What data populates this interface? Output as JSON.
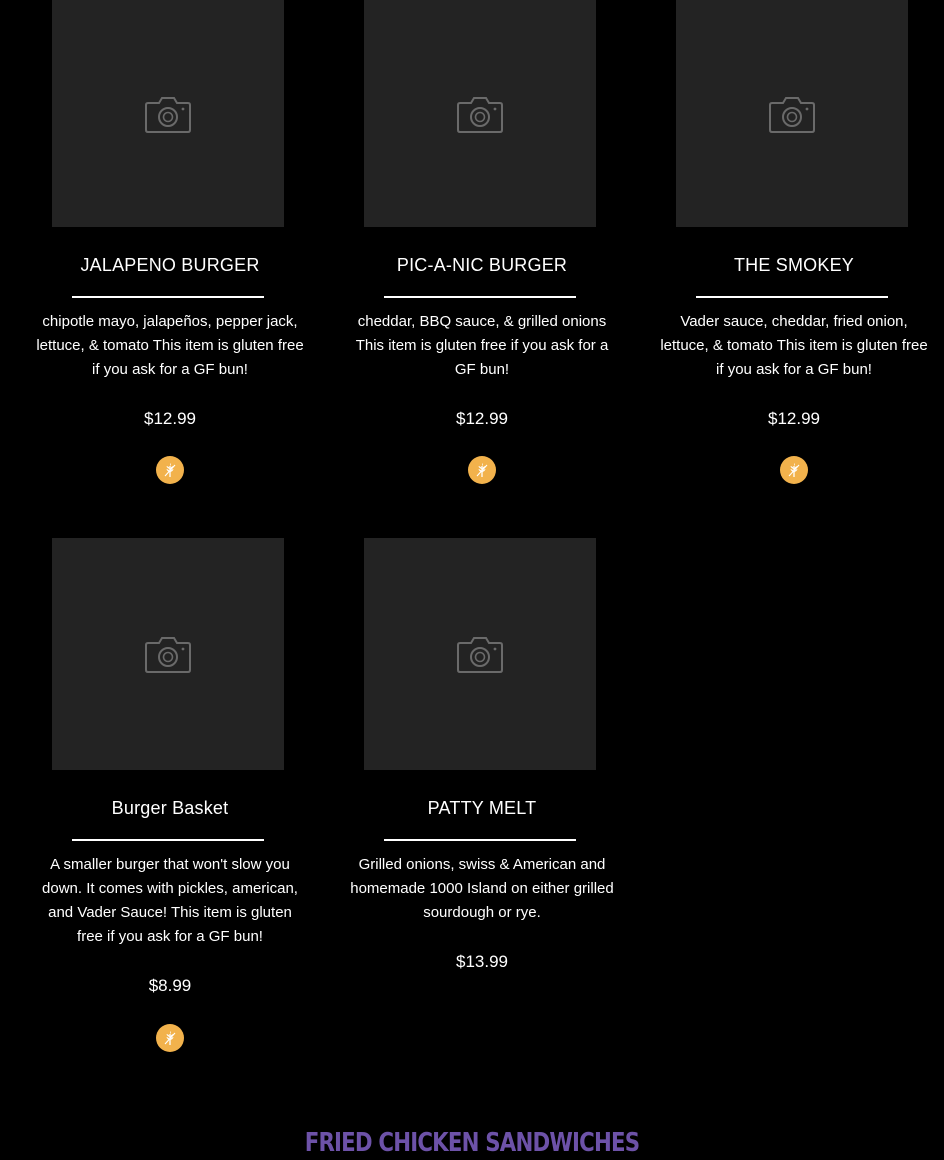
{
  "colors": {
    "background": "#000000",
    "photo_placeholder": "#232323",
    "camera_icon": "#6a6a6a",
    "gluten_free_badge": "#f2b24c",
    "section_heading": "#6d52a8"
  },
  "menu_items": [
    {
      "name": "JALAPENO BURGER",
      "description": "chipotle mayo, jalapeños, pepper jack, lettuce, & tomato This item is gluten free if you ask for a GF bun!",
      "price": "$12.99",
      "gluten_free_icon": "wheat-icon"
    },
    {
      "name": "PIC-A-NIC BURGER",
      "description": "cheddar, BBQ sauce, & grilled onions This item is gluten free if you ask for a GF bun!",
      "price": "$12.99",
      "gluten_free_icon": "wheat-icon"
    },
    {
      "name": "THE SMOKEY",
      "description": "Vader sauce, cheddar, fried onion, lettuce, & tomato This item is gluten free if you ask for a GF bun!",
      "price": "$12.99",
      "gluten_free_icon": "wheat-icon"
    },
    {
      "name": "Burger Basket",
      "description": "A smaller burger that won't slow you down. It comes with pickles, american, and Vader Sauce! This item is gluten free if you ask for a GF bun!",
      "price": "$8.99",
      "gluten_free_icon": "wheat-icon"
    },
    {
      "name": "PATTY MELT",
      "description": "Grilled onions, swiss & American and homemade 1000 Island on either grilled sourdough or rye.",
      "price": "$13.99"
    }
  ],
  "placeholder_icon": "camera-icon",
  "next_section": {
    "heading": "FRIED CHICKEN SANDWICHES"
  }
}
